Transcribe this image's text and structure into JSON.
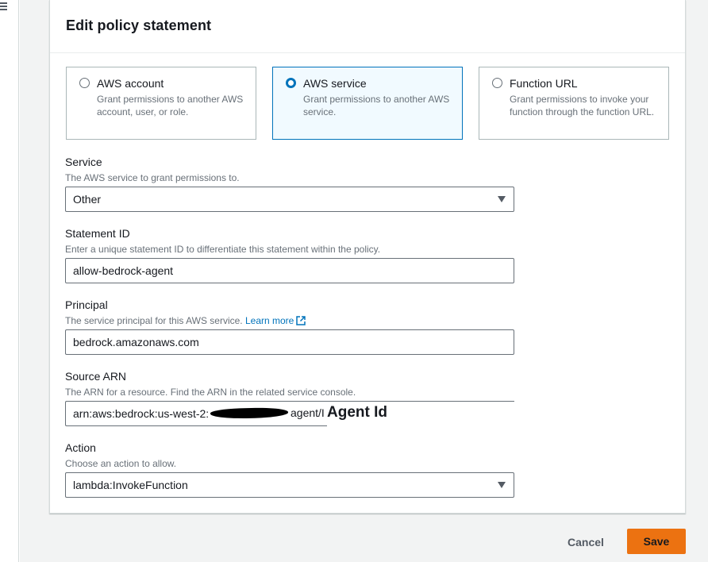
{
  "panel": {
    "title": "Edit policy statement"
  },
  "principal_types": [
    {
      "label": "AWS account",
      "description": "Grant permissions to another AWS account, user, or role.",
      "selected": false
    },
    {
      "label": "AWS service",
      "description": "Grant permissions to another AWS service.",
      "selected": true
    },
    {
      "label": "Function URL",
      "description": "Grant permissions to invoke your function through the function URL.",
      "selected": false
    }
  ],
  "service": {
    "label": "Service",
    "description": "The AWS service to grant permissions to.",
    "value": "Other"
  },
  "statement_id": {
    "label": "Statement ID",
    "description": "Enter a unique statement ID to differentiate this statement within the policy.",
    "value": "allow-bedrock-agent"
  },
  "principal": {
    "label": "Principal",
    "description": "The service principal for this AWS service.",
    "link": "Learn more",
    "value": "bedrock.amazonaws.com"
  },
  "source_arn": {
    "label": "Source ARN",
    "description": "The ARN for a resource. Find the ARN in the related service console.",
    "value_prefix": "arn:aws:bedrock:us-west-2:",
    "value_suffix": "agent/I",
    "annotation": "Agent Id"
  },
  "action": {
    "label": "Action",
    "description": "Choose an action to allow.",
    "value": "lambda:InvokeFunction"
  },
  "footer": {
    "cancel": "Cancel",
    "save": "Save"
  },
  "colors": {
    "accent": "#0073bb",
    "primary_button": "#ec7211",
    "selected_tile_bg": "#f1faff"
  },
  "icons": {
    "menu": "hamburger-icon",
    "external_link": "external-link-icon",
    "dropdown": "caret-down-icon"
  }
}
